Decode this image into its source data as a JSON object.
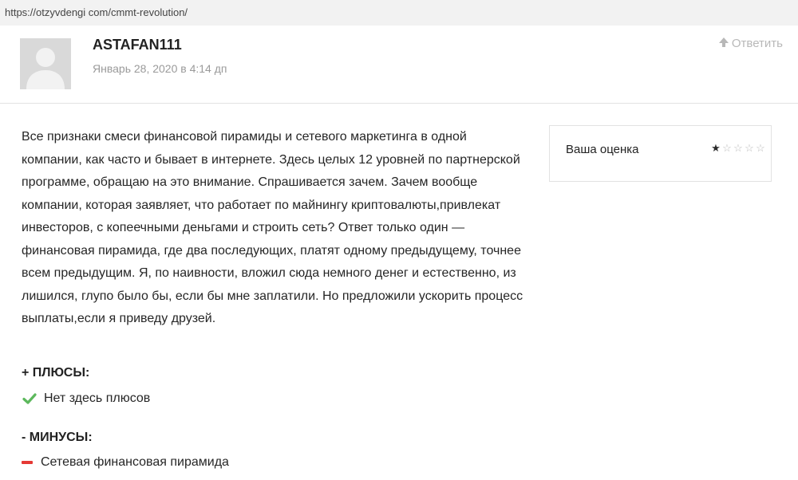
{
  "url": "https://otzyvdengi com/cmmt-revolution/",
  "comment": {
    "author": "ASTAFAN111",
    "date": "Январь 28, 2020 в 4:14 дп",
    "reply_label": "Ответить",
    "text": "Все признаки смеси финансовой пирамиды и сетевого маркетинга в одной компании, как часто и бывает в интернете. Здесь целых 12 уровней по партнерской программе, обращаю на это внимание. Спрашивается зачем. Зачем вообще компании, которая заявляет, что работает по майнингу криптовалюты,привлекат инвесторов, с копеечными деньгами и строить сеть? Ответ только один — финансовая пирамида, где два последующих, платят одному предыдущему, точнее всем предыдущим. Я, по наивности, вложил сюда немного денег и естественно, из лишился, глупо было бы, если бы мне заплатили. Но предложили ускорить процесс выплаты,если я приведу друзей."
  },
  "rating": {
    "label": "Ваша оценка",
    "value": 1,
    "max": 10
  },
  "pros": {
    "title": "+ ПЛЮСЫ:",
    "items": [
      "Нет здесь плюсов"
    ]
  },
  "cons": {
    "title": "- МИНУСЫ:",
    "items": [
      "Сетевая финансовая пирамида"
    ]
  },
  "colors": {
    "check": "#5cb85c",
    "minus": "#e53935",
    "muted": "#9a9a9a"
  }
}
